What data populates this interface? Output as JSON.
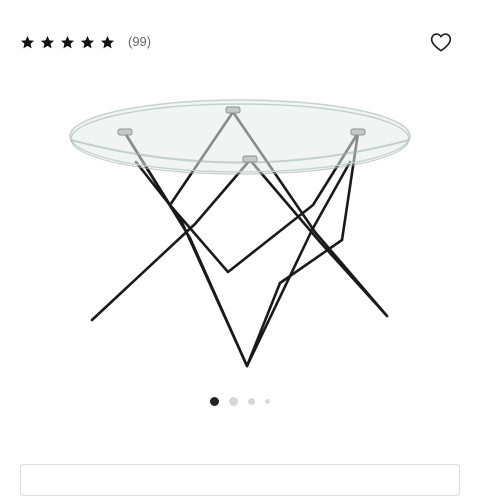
{
  "rating": {
    "stars": 5,
    "review_count": "(99)"
  },
  "icons": {
    "star": "star-icon",
    "wishlist": "heart-outline-icon"
  },
  "carousel": {
    "total_slides": 4,
    "active_index": 0
  },
  "colors": {
    "star": "#111111",
    "legs": "#1a1a1a",
    "dot_active": "#222222",
    "dot_inactive": "#d8d8d8"
  }
}
